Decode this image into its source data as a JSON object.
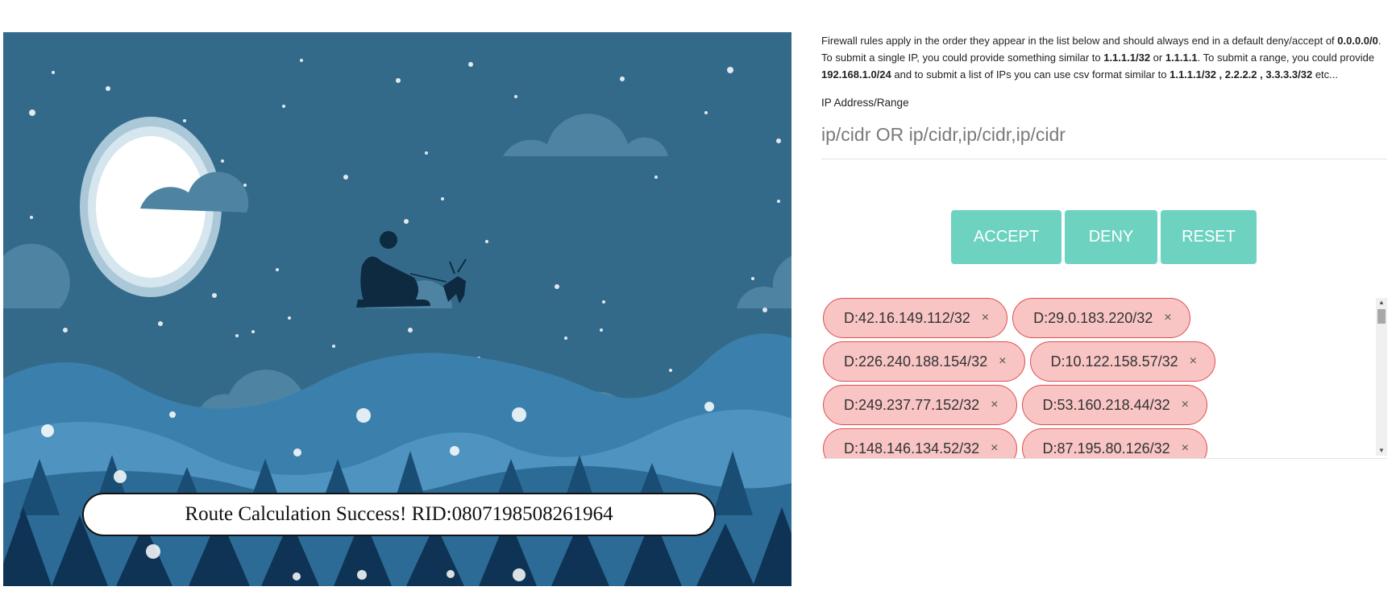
{
  "banner": {
    "text": "Route Calculation Success! RID:0807198508261964"
  },
  "intro": {
    "p1": "Firewall rules apply in the order they appear in the list below and should always end in a default deny/accept of ",
    "b1": "0.0.0.0/0",
    "p2": ". To submit a single IP, you could provide something similar to ",
    "b2": "1.1.1.1/32",
    "p3": " or ",
    "b3": "1.1.1.1",
    "p4": ". To submit a range, you could provide ",
    "b4": "192.168.1.0/24",
    "p5": " and to submit a list of IPs you can use csv format similar to ",
    "b5": "1.1.1.1/32 , 2.2.2.2 , 3.3.3.3/32",
    "p6": " etc..."
  },
  "ip_field": {
    "label": "IP Address/Range",
    "placeholder": "ip/cidr OR ip/cidr,ip/cidr,ip/cidr",
    "value": ""
  },
  "buttons": {
    "accept": "ACCEPT",
    "deny": "DENY",
    "reset": "RESET"
  },
  "rules": [
    {
      "label": "D:42.16.149.112/32",
      "remove": "×"
    },
    {
      "label": "D:29.0.183.220/32",
      "remove": "×"
    },
    {
      "label": "D:226.240.188.154/32",
      "remove": "×"
    },
    {
      "label": "D:10.122.158.57/32",
      "remove": "×"
    },
    {
      "label": "D:249.237.77.152/32",
      "remove": "×"
    },
    {
      "label": "D:53.160.218.44/32",
      "remove": "×"
    },
    {
      "label": "D:148.146.134.52/32",
      "remove": "×"
    },
    {
      "label": "D:87.195.80.126/32",
      "remove": "×"
    }
  ],
  "colors": {
    "rule_bg": "#f8c4c4",
    "rule_border": "#e04e4e",
    "button": "#6dd3c0",
    "sky": "#336a8a"
  }
}
